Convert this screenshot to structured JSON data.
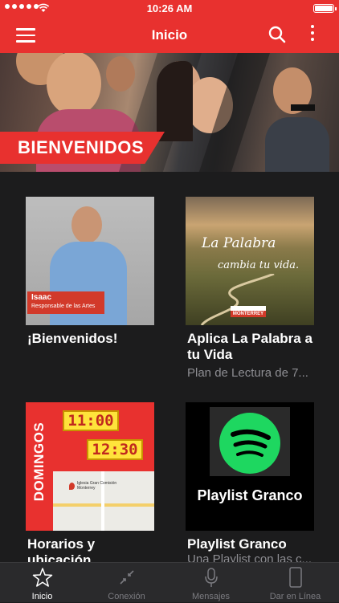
{
  "status_bar": {
    "time": "10:26 AM"
  },
  "nav": {
    "title": "Inicio"
  },
  "hero": {
    "banner_text": "BIENVENIDOS"
  },
  "cards": [
    {
      "title": "¡Bienvenidos!",
      "subtitle": "",
      "thumb_name": "Isaac",
      "thumb_role": "Responsable de las Artes"
    },
    {
      "title": "Aplica La Palabra a tu Vida",
      "subtitle": "Plan de Lectura de 7...",
      "thumb_line1": "La Palabra",
      "thumb_line2": "cambia tu vida.",
      "thumb_logo": "MONTERREY"
    },
    {
      "title": "Horarios y ubicación",
      "subtitle": "",
      "thumb_day": "DOMINGOS",
      "thumb_time1": "11:00",
      "thumb_time2": "12:30",
      "thumb_map_label": "Iglesia Gran Comisión Monterrey"
    },
    {
      "title": "Playlist Granco",
      "subtitle": "Una Playlist con las c...",
      "thumb_label": "Playlist Granco"
    }
  ],
  "tabs": [
    {
      "label": "Inicio",
      "icon": "star-icon"
    },
    {
      "label": "Conexión",
      "icon": "connect-icon"
    },
    {
      "label": "Mensajes",
      "icon": "microphone-icon"
    },
    {
      "label": "Dar en Línea",
      "icon": "phone-icon"
    }
  ],
  "colors": {
    "accent": "#e8312f",
    "background": "#1c1c1d",
    "tabbar": "#2a2a2c"
  }
}
